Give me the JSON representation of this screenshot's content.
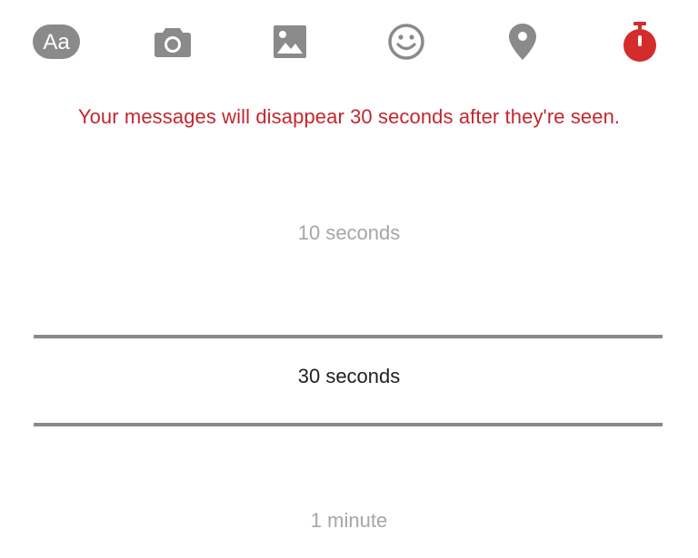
{
  "toolbar": {
    "items": [
      {
        "icon": "text-aa-icon",
        "label": "Aa"
      },
      {
        "icon": "camera-icon"
      },
      {
        "icon": "gallery-icon"
      },
      {
        "icon": "emoji-icon"
      },
      {
        "icon": "location-pin-icon"
      },
      {
        "icon": "timer-icon",
        "active": true
      }
    ],
    "icon_color": "#8a8a8a",
    "active_color": "#d42b2b"
  },
  "notice": {
    "text": "Your messages will disappear 30 seconds after they're seen.",
    "color": "#c4262e"
  },
  "picker": {
    "options": [
      {
        "label": "10 seconds",
        "selected": false
      },
      {
        "label": "30 seconds",
        "selected": true
      },
      {
        "label": "1 minute",
        "selected": false
      }
    ]
  }
}
